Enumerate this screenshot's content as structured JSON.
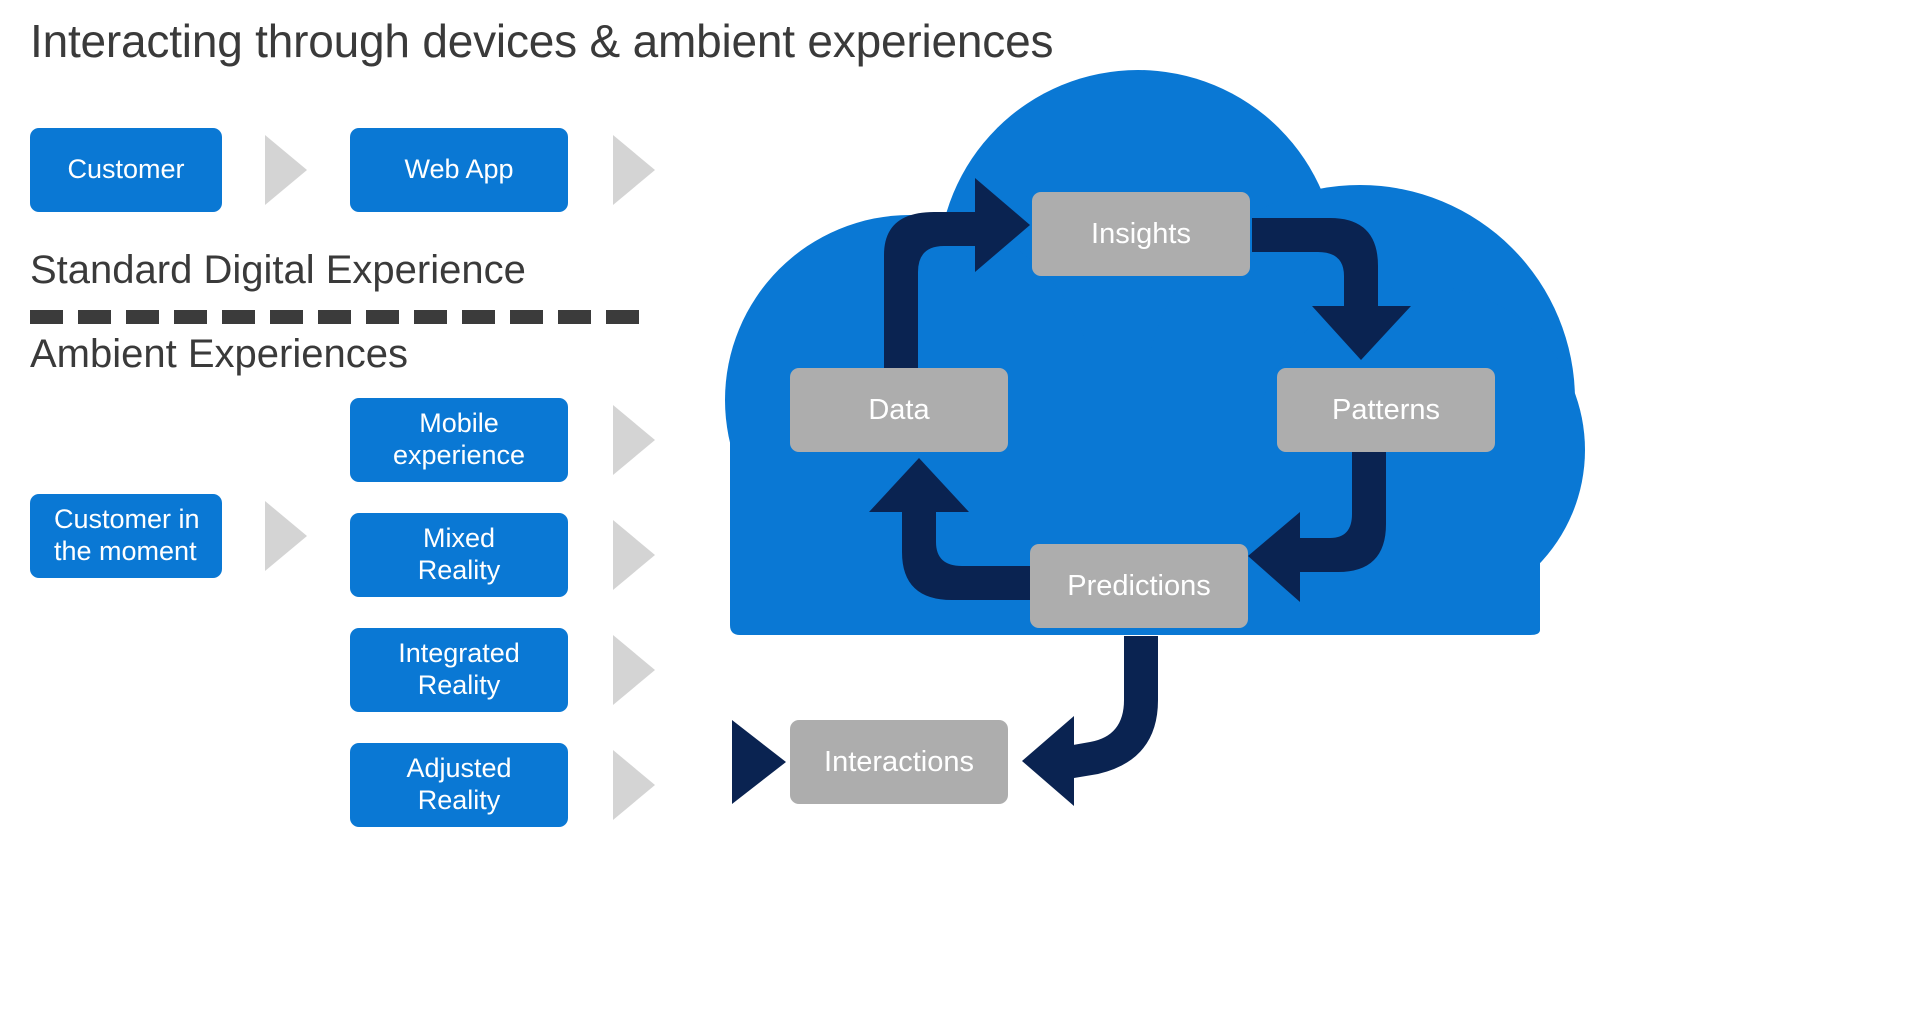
{
  "slide": {
    "title": "Interacting through devices & ambient experiences",
    "background_color": "#ffffff"
  },
  "colors": {
    "brand_blue": "#0a78d4",
    "cloud_blue": "#0a78d4",
    "gray_box": "#adadad",
    "navy_arrow": "#0a2351",
    "chevron_gray": "#d4d4d4",
    "text_dark": "#3a3a3a",
    "divider_dark": "#3b3b3b"
  },
  "left_panel": {
    "sections": [
      {
        "id": "standard",
        "label": "Standard Digital Experience"
      },
      {
        "id": "ambient",
        "label": "Ambient Experiences"
      }
    ],
    "divider": {
      "name": "dashed-divider",
      "dash_count": 13
    },
    "standard_flow": {
      "nodes": [
        {
          "id": "customer",
          "label": "Customer"
        },
        {
          "id": "web-app",
          "label": "Web App"
        }
      ],
      "chevrons": 2
    },
    "ambient_flow": {
      "source": {
        "id": "customer-in-the-moment",
        "line1": "Customer in",
        "line2": "the moment"
      },
      "targets": [
        {
          "id": "mobile-experience",
          "line1": "Mobile",
          "line2": "experience"
        },
        {
          "id": "mixed-reality",
          "line1": "Mixed",
          "line2": "Reality"
        },
        {
          "id": "integrated-reality",
          "line1": "Integrated",
          "line2": "Reality"
        },
        {
          "id": "adjusted-reality",
          "line1": "Adjusted",
          "line2": "Reality"
        }
      ],
      "chevrons": 5
    }
  },
  "cloud": {
    "name": "cloud-shape",
    "cycle_nodes": [
      {
        "id": "data",
        "label": "Data"
      },
      {
        "id": "insights",
        "label": "Insights"
      },
      {
        "id": "patterns",
        "label": "Patterns"
      },
      {
        "id": "predictions",
        "label": "Predictions"
      }
    ],
    "external_node": {
      "id": "interactions",
      "label": "Interactions"
    },
    "arrows": [
      {
        "id": "data-to-insights",
        "from": "Data",
        "to": "Insights",
        "direction": "up-right"
      },
      {
        "id": "insights-to-patterns",
        "from": "Insights",
        "to": "Patterns",
        "direction": "right-down"
      },
      {
        "id": "patterns-to-predictions",
        "from": "Patterns",
        "to": "Predictions",
        "direction": "down-left"
      },
      {
        "id": "predictions-to-data",
        "from": "Predictions",
        "to": "Data",
        "direction": "left-up"
      },
      {
        "id": "predictions-to-interactions",
        "from": "Predictions",
        "to": "Interactions",
        "direction": "down-left"
      },
      {
        "id": "interactions-out",
        "from": "Interactions",
        "to": "customer",
        "direction": "left"
      }
    ]
  }
}
